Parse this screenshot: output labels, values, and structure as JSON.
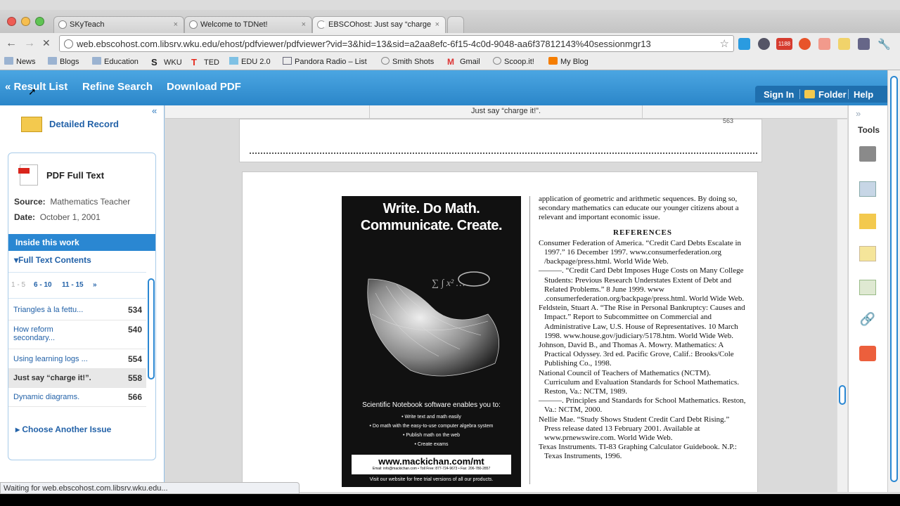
{
  "browser": {
    "tabs": [
      {
        "title": "SKyTeach",
        "close": "×"
      },
      {
        "title": "Welcome to TDNet!",
        "close": "×"
      },
      {
        "title": "EBSCOhost: Just say “charge",
        "close": "×"
      }
    ],
    "address": "web.ebscohost.com.libsrv.wku.edu/ehost/pdfviewer/pdfviewer?vid=3&hid=13&sid=a2aa8efc-6f15-4c0d-9048-aa6f37812143%40sessionmgr13",
    "extension_badge": "1188",
    "bookmarks": [
      {
        "label": "News",
        "icon": "folder-icon"
      },
      {
        "label": "Blogs",
        "icon": "folder-icon"
      },
      {
        "label": "Education",
        "icon": "folder-icon"
      },
      {
        "label": "WKU",
        "icon": "s-logo-icon"
      },
      {
        "label": "TED",
        "icon": "t-logo-icon"
      },
      {
        "label": "EDU 2.0",
        "icon": "edu-icon"
      },
      {
        "label": "Pandora Radio – List",
        "icon": "p-logo-icon"
      },
      {
        "label": "Smith Shots",
        "icon": "globe-icon"
      },
      {
        "label": "Gmail",
        "icon": "gmail-icon"
      },
      {
        "label": "Scoop.it!",
        "icon": "globe-icon"
      },
      {
        "label": "My Blog",
        "icon": "blogger-icon"
      }
    ],
    "status": "Waiting for web.ebscohost.com.libsrv.wku.edu..."
  },
  "header": {
    "result_list": "« Result List",
    "refine": "Refine Search",
    "download": "Download PDF",
    "sign_in": "Sign In",
    "folder": "Folder",
    "help": "Help"
  },
  "left": {
    "collapse": "«",
    "detailed_record": "Detailed Record",
    "pdf_full_text": "PDF Full Text",
    "source_label": "Source:",
    "source": "Mathematics Teacher",
    "date_label": "Date:",
    "date": "October 1,  2001",
    "inside": "Inside this work",
    "full_text_contents": "Full Text Contents",
    "pager": [
      "1 - 5",
      "6 - 10",
      "11 - 15",
      "»"
    ],
    "toc": [
      {
        "title": "Triangles à la fettu...",
        "page": "534"
      },
      {
        "title": "How reform secondary...",
        "page": "540"
      },
      {
        "title": "Using learning logs ...",
        "page": "554"
      },
      {
        "title": "Just say “charge it!”.",
        "page": "558"
      },
      {
        "title": "Dynamic diagrams.",
        "page": "566"
      }
    ],
    "choose_another": "Choose Another Issue"
  },
  "viewer": {
    "header_title": "Just say “charge it!”.",
    "prev_page_number": "563",
    "ad": {
      "headline_1": "Write. Do Math.",
      "headline_2": "Communicate. Create.",
      "product_line": "Scientific Notebook   software enables you to:",
      "bullets": [
        "• Write text and math easily",
        "• Do math with the easy-to-use computer algebra system",
        "• Publish math on the web",
        "• Create exams"
      ],
      "url": "www.mackichan.com/mt",
      "contact": "Email: info@mackichan.com • Toll Free: 877-724-9673 • Fax: 206-780-2857",
      "visit": "Visit our website for free trial versions of all our products."
    },
    "text": {
      "intro": "application of geometric and arithmetic sequences. By doing so, secondary mathematics can educate our younger citizens about a relevant and important economic issue.",
      "heading": "REFERENCES",
      "refs": [
        "Consumer Federation of America. “Credit Card Debts Escalate in 1997.” 16 December 1997. www.consumerfederation.org /backpage/press.html. World Wide Web.",
        "———. “Credit Card Debt Imposes Huge Costs on Many College Students: Previous Research Understates Extent of Debt and Related Problems.” 8 June 1999. www .consumerfederation.org/backpage/press.html. World Wide Web.",
        "Feldstein, Stuart A. “The Rise in Personal Bankruptcy: Causes and Impact.” Report to Subcommittee on Commercial and Administrative Law, U.S. House of Representatives. 10 March 1998. www.house.gov/judiciary/5178.htm. World Wide Web.",
        "Johnson, David B., and Thomas A. Mowry. Mathematics: A Practical Odyssey. 3rd ed. Pacific Grove, Calif.: Brooks/Cole Publishing Co., 1998.",
        "National Council of Teachers of Mathematics (NCTM). Curriculum and Evaluation Standards for School Mathematics. Reston, Va.: NCTM, 1989.",
        "———. Principles and Standards for School Mathematics. Reston, Va.: NCTM, 2000.",
        "Nellie Mae. “Study Shows Student Credit Card Debt Rising.” Press release dated 13 February 2001. Available at www.prnewswire.com. World Wide Web.",
        "Texas Instruments. TI-83 Graphing Calculator Guidebook. N.P.: Texas Instruments, 1996."
      ]
    }
  },
  "tools": {
    "title": "Tools",
    "expand": "»"
  },
  "colors": {
    "accent": "#2a87d2",
    "header_top": "#4ba6e2",
    "link": "#2362a8"
  }
}
